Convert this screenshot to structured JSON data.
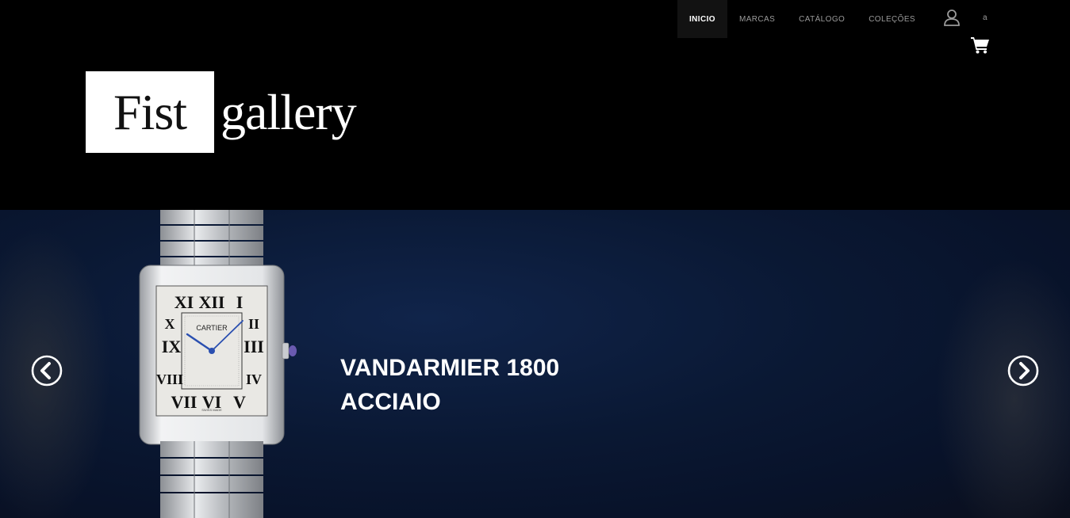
{
  "nav": {
    "items": [
      {
        "label": "INICIO",
        "active": true
      },
      {
        "label": "MARCAS",
        "active": false
      },
      {
        "label": "CATÁLOGO",
        "active": false
      },
      {
        "label": "COLEÇÕES",
        "active": false
      }
    ],
    "user_icon": "user-icon",
    "user_label": "a",
    "cart_icon": "shopping-cart-icon"
  },
  "logo": {
    "word1": "Fist",
    "word2": "gallery"
  },
  "hero": {
    "slide_title_line1": "VANDARMIER 1800",
    "slide_title_line2": "ACCIAIO",
    "watch_brand": "CARTIER",
    "watch_sub": "SWISS MADE",
    "prev_icon": "chevron-left-circle-icon",
    "next_icon": "chevron-right-circle-icon"
  },
  "colors": {
    "background": "#000000",
    "hero_blue": "#0a1833",
    "nav_active_bg": "#121212",
    "nav_text": "#9a9a9a",
    "accent_hand": "#2a4fb0"
  }
}
